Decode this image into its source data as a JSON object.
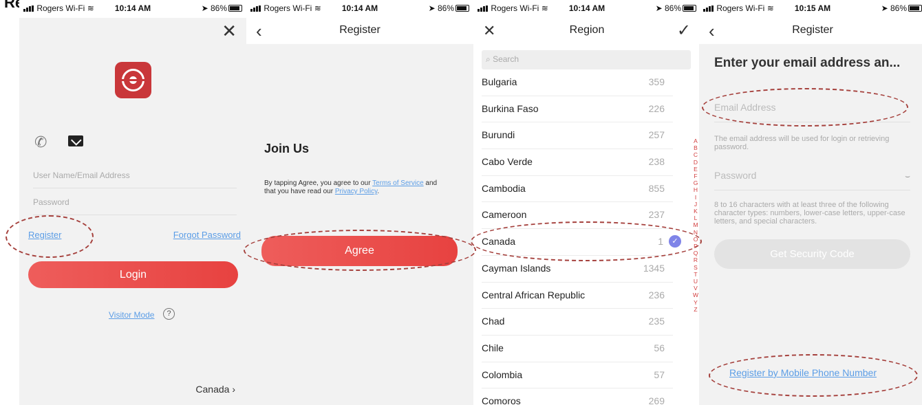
{
  "top_title": "Re",
  "status": [
    {
      "carrier": "Rogers Wi-Fi",
      "time": "10:14 AM",
      "battery": "86%"
    },
    {
      "carrier": "Rogers Wi-Fi",
      "time": "10:14 AM",
      "battery": "86%"
    },
    {
      "carrier": "Rogers Wi-Fi",
      "time": "10:14 AM",
      "battery": "86%"
    },
    {
      "carrier": "Rogers Wi-Fi",
      "time": "10:15 AM",
      "battery": "86%"
    }
  ],
  "login": {
    "username_placeholder": "User Name/Email Address",
    "password_placeholder": "Password",
    "register": "Register",
    "forgot": "Forgot Password",
    "login_button": "Login",
    "visitor": "Visitor Mode",
    "help": "?",
    "region": "Canada",
    "region_chevron": "›"
  },
  "register": {
    "title": "Register",
    "join": "Join Us",
    "terms_prefix": "By tapping Agree, you agree to our",
    "terms_link": "Terms of Service",
    "terms_mid": "and that you have read our",
    "privacy_link": "Privacy Policy",
    "terms_end": ".",
    "agree": "Agree"
  },
  "region": {
    "title": "Region",
    "search_placeholder": "Search",
    "countries": [
      {
        "name": "Bulgaria",
        "code": "359"
      },
      {
        "name": "Burkina Faso",
        "code": "226"
      },
      {
        "name": "Burundi",
        "code": "257"
      },
      {
        "name": "Cabo Verde",
        "code": "238"
      },
      {
        "name": "Cambodia",
        "code": "855"
      },
      {
        "name": "Cameroon",
        "code": "237"
      },
      {
        "name": "Canada",
        "code": "1",
        "selected": true
      },
      {
        "name": "Cayman Islands",
        "code": "1345"
      },
      {
        "name": "Central African Republic",
        "code": "236"
      },
      {
        "name": "Chad",
        "code": "235"
      },
      {
        "name": "Chile",
        "code": "56"
      },
      {
        "name": "Colombia",
        "code": "57"
      },
      {
        "name": "Comoros",
        "code": "269"
      }
    ],
    "alphabet": [
      "A",
      "B",
      "C",
      "D",
      "E",
      "F",
      "G",
      "H",
      "I",
      "J",
      "K",
      "L",
      "M",
      "N",
      "O",
      "P",
      "Q",
      "R",
      "S",
      "T",
      "U",
      "V",
      "W",
      "Y",
      "Z"
    ]
  },
  "email_register": {
    "title": "Register",
    "heading": "Enter your email address an...",
    "email_placeholder": "Email Address",
    "email_hint": "The email address will be used for login or retrieving password.",
    "password_placeholder": "Password",
    "password_hint": "8 to 16 characters with at least three of the following character types: numbers, lower-case letters, upper-case letters, and special characters.",
    "get_code": "Get Security Code",
    "mobile_link": "Register by Mobile Phone Number"
  },
  "colors": {
    "accent": "#e74240",
    "link": "#5b9de6",
    "annotation": "#a5403c",
    "check": "#7f84e8"
  }
}
